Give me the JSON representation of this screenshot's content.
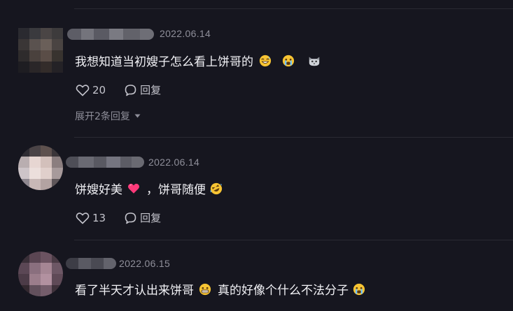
{
  "comments": [
    {
      "date": "2022.06.14",
      "text_before": "我想知道当初嫂子怎么看上饼哥的",
      "emojis": [
        "grinning-sweat-face",
        "crying-face",
        "cat-face"
      ],
      "likes": "20",
      "reply_label": "回复",
      "expand_label": "展开2条回复"
    },
    {
      "date": "2022.06.14",
      "text_part1": "饼嫂好美",
      "text_part2": "，饼哥随便",
      "emojis": [
        "pink-heart",
        "rolling-laughing-face"
      ],
      "likes": "13",
      "reply_label": "回复"
    },
    {
      "date": "2022.06.15",
      "text_part1": "看了半天才认出来饼哥",
      "text_part2": "真的好像个什么不法分子",
      "emojis": [
        "grimacing-face",
        "crying-face"
      ]
    }
  ],
  "colors": {
    "background": "#16161f",
    "text": "#f1f1f5",
    "meta": "#8f8f9a",
    "action": "#c4c4cc",
    "heart": "#ff3a7a"
  }
}
